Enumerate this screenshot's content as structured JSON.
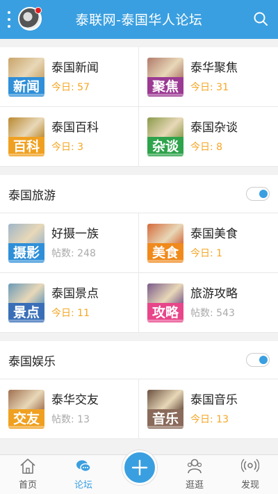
{
  "header": {
    "title": "泰联网-泰国华人论坛"
  },
  "top_grid": [
    {
      "title": "泰国新闻",
      "tag": "新闻",
      "stat_label": "今日",
      "stat_value": "57",
      "kind": "today",
      "tag_color": "#2f8fd8",
      "img_color": "#c9a46a"
    },
    {
      "title": "泰华聚焦",
      "tag": "聚焦",
      "stat_label": "今日",
      "stat_value": "31",
      "kind": "today",
      "tag_color": "#9b3a93",
      "img_color": "#b07a6a"
    },
    {
      "title": "泰国百科",
      "tag": "百科",
      "stat_label": "今日",
      "stat_value": "3",
      "kind": "today",
      "tag_color": "#f0a020",
      "img_color": "#b98930"
    },
    {
      "title": "泰国杂谈",
      "tag": "杂谈",
      "stat_label": "今日",
      "stat_value": "8",
      "kind": "today",
      "tag_color": "#2ea34b",
      "img_color": "#8a9a4a"
    }
  ],
  "sections": [
    {
      "title": "泰国旅游",
      "items": [
        {
          "title": "好摄一族",
          "tag": "摄影",
          "stat_label": "帖数",
          "stat_value": "248",
          "kind": "posts",
          "tag_color": "#2f8fd8",
          "img_color": "#9fb6c8"
        },
        {
          "title": "泰国美食",
          "tag": "美食",
          "stat_label": "今日",
          "stat_value": "1",
          "kind": "today",
          "tag_color": "#f08a1c",
          "img_color": "#d46a3a"
        },
        {
          "title": "泰国景点",
          "tag": "景点",
          "stat_label": "今日",
          "stat_value": "11",
          "kind": "today",
          "tag_color": "#3a6fb8",
          "img_color": "#6a9ab8"
        },
        {
          "title": "旅游攻略",
          "tag": "攻略",
          "stat_label": "帖数",
          "stat_value": "543",
          "kind": "posts",
          "tag_color": "#e8468a",
          "img_color": "#7a5a8a"
        }
      ]
    },
    {
      "title": "泰国娱乐",
      "items": [
        {
          "title": "泰华交友",
          "tag": "交友",
          "stat_label": "帖数",
          "stat_value": "13",
          "kind": "posts",
          "tag_color": "#f0a020",
          "img_color": "#a07050"
        },
        {
          "title": "泰国音乐",
          "tag": "音乐",
          "stat_label": "今日",
          "stat_value": "13",
          "kind": "today",
          "tag_color": "#8a6a5a",
          "img_color": "#6a5040"
        }
      ]
    }
  ],
  "tabbar": {
    "home": "首页",
    "forum": "论坛",
    "browse": "逛逛",
    "discover": "发现"
  },
  "colors": {
    "accent": "#3a9fe0",
    "today": "#f5a623",
    "posts": "#aaaaaa"
  }
}
